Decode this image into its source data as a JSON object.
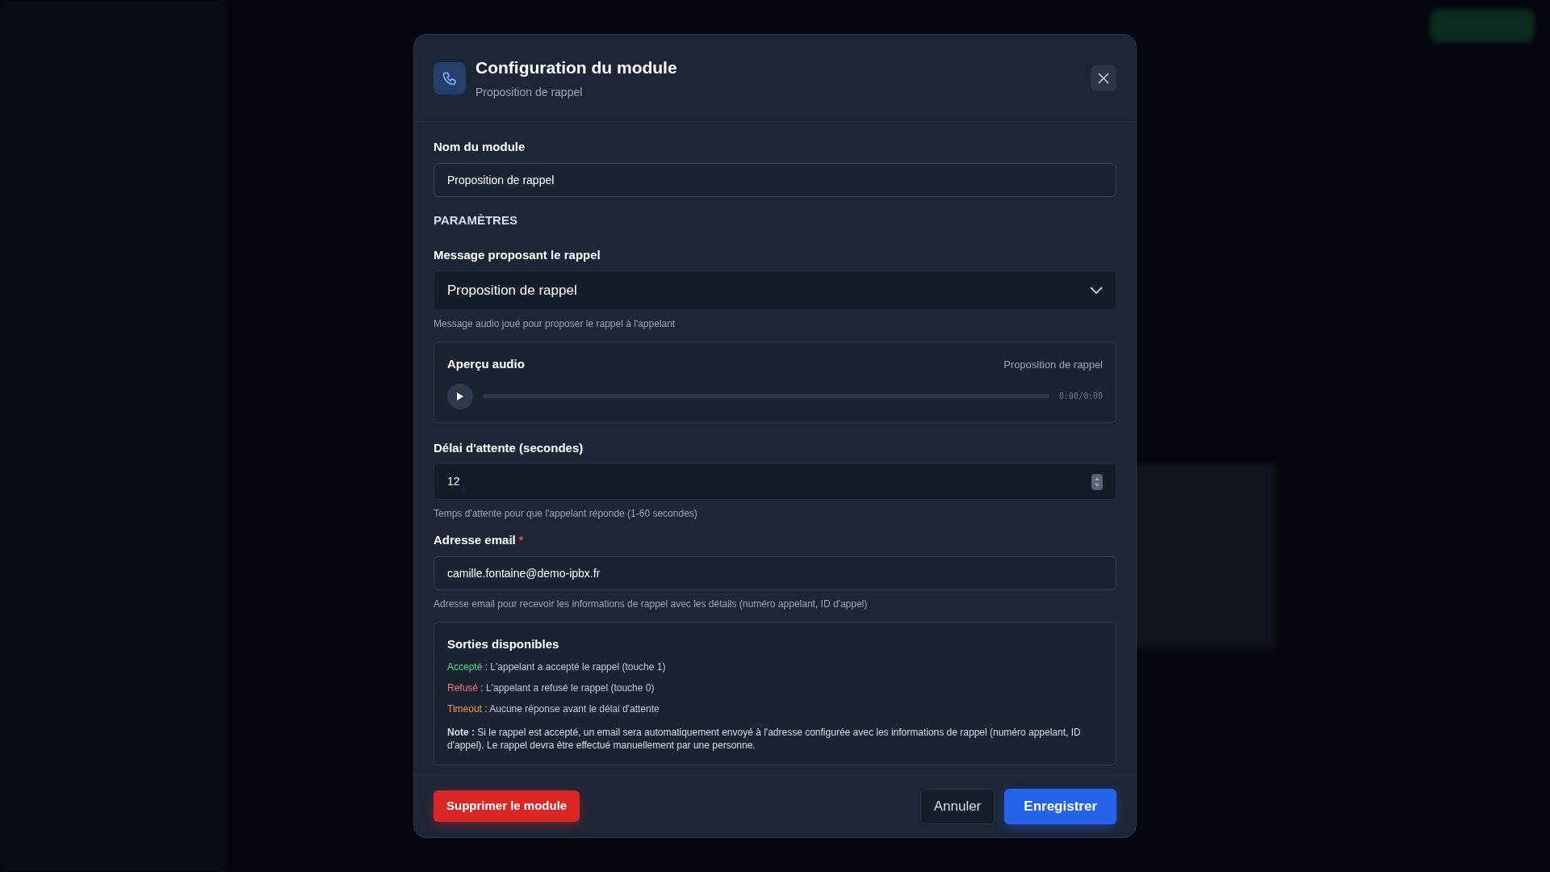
{
  "dialog": {
    "title": "Configuration du module",
    "subtitle": "Proposition de rappel"
  },
  "fields": [
    {
      "kind": "text",
      "label": "Nom du module",
      "value": "Proposition de rappel"
    },
    {
      "kind": "section",
      "label": "PARAMÈTRES"
    },
    {
      "kind": "select",
      "label": "Message proposant le rappel",
      "value": "Proposition de rappel",
      "help": "Message audio joué pour proposer le rappel à l'appelant"
    },
    {
      "kind": "audio",
      "label": "Aperçu audio",
      "file": "Proposition de rappel",
      "time": "0:00/0:00"
    },
    {
      "kind": "number",
      "label": "Délai d'attente (secondes)",
      "value": "12",
      "help": "Temps d'attente pour que l'appelant réponde (1-60 secondes)"
    },
    {
      "kind": "text",
      "label": "Adresse email",
      "required_mark": "*",
      "value": "camille.fontaine@demo-ipbx.fr",
      "help": "Adresse email pour recevoir les informations de rappel avec les détails (numéro appelant, ID d'appel)"
    }
  ],
  "outputs": {
    "title": "Sorties disponibles",
    "items": [
      {
        "name": "Accepté",
        "color": "#4ade80",
        "description": " : L'appelant a accepté le rappel (touche 1)"
      },
      {
        "name": "Refusé",
        "color": "#f87171",
        "description": " : L'appelant a refusé le rappel (touche 0)"
      },
      {
        "name": "Timeout",
        "color": "#fb923c",
        "description": " : Aucune réponse avant le délai d'attente"
      }
    ],
    "note": "**Note :** Si le rappel est accepté, un email sera automatiquement envoyé à l'adresse configurée avec les informations de rappel (numéro appelant, ID d'appel). Le rappel devra être effectué manuellement par une personne."
  },
  "buttons": {
    "delete": "Supprimer le module",
    "cancel": "Annuler",
    "save": "Enregistrer"
  }
}
